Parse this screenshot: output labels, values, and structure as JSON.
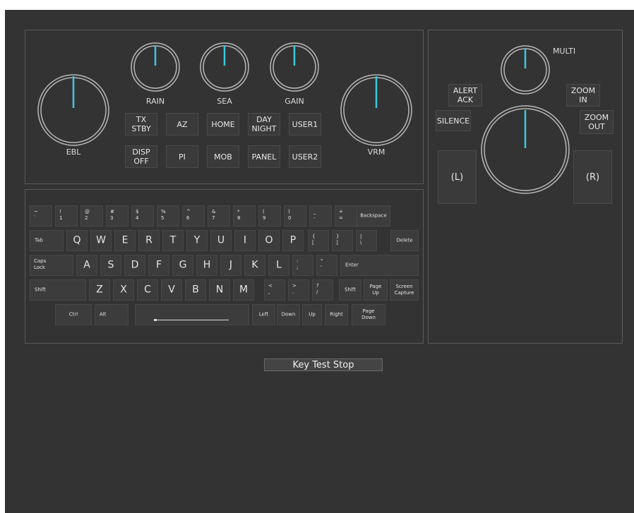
{
  "colors": {
    "background": "#333333",
    "needle": "#3cc8e0",
    "knob_ring": "#b8b8b8"
  },
  "knobs": {
    "ebl": "EBL",
    "rain": "RAIN",
    "sea": "SEA",
    "gain": "GAIN",
    "vrm": "VRM",
    "multi": "MULTI"
  },
  "buttons": {
    "tx_stby": "TX\nSTBY",
    "az": "AZ",
    "home": "HOME",
    "day_night": "DAY\nNIGHT",
    "user1": "USER1",
    "disp_off": "DISP\nOFF",
    "pi": "PI",
    "mob": "MOB",
    "panel": "PANEL",
    "user2": "USER2",
    "alert_ack": "ALERT\nACK",
    "zoom_in": "ZOOM\nIN",
    "silence": "SILENCE",
    "zoom_out": "ZOOM\nOUT",
    "left_click": "(L)",
    "right_click": "(R)"
  },
  "keyboard": {
    "row1": [
      {
        "t": "~",
        "b": "`"
      },
      {
        "t": "!",
        "b": "1"
      },
      {
        "t": "@",
        "b": "2"
      },
      {
        "t": "#",
        "b": "3"
      },
      {
        "t": "$",
        "b": "4"
      },
      {
        "t": "%",
        "b": "5"
      },
      {
        "t": "^",
        "b": "6"
      },
      {
        "t": "&",
        "b": "7"
      },
      {
        "t": "*",
        "b": "8"
      },
      {
        "t": "(",
        "b": "9"
      },
      {
        "t": ")",
        "b": "0"
      },
      {
        "t": "_",
        "b": "-"
      },
      {
        "t": "+",
        "b": "="
      }
    ],
    "backspace": "Backspace",
    "tab": "Tab",
    "row2_letters": [
      "Q",
      "W",
      "E",
      "R",
      "T",
      "Y",
      "U",
      "I",
      "O",
      "P"
    ],
    "row2_sym": [
      {
        "t": "{",
        "b": "["
      },
      {
        "t": "}",
        "b": "]"
      },
      {
        "t": "|",
        "b": "\\"
      }
    ],
    "delete": "Delete",
    "caps": "Caps\nLock",
    "row3_letters": [
      "A",
      "S",
      "D",
      "F",
      "G",
      "H",
      "J",
      "K",
      "L"
    ],
    "row3_sym": [
      {
        "t": ":",
        "b": ";"
      },
      {
        "t": "\"",
        "b": "'"
      }
    ],
    "enter": "Enter",
    "shift_left": "Shift",
    "row4_letters": [
      "Z",
      "X",
      "C",
      "V",
      "B",
      "N",
      "M"
    ],
    "row4_sym": [
      {
        "t": "<",
        "b": ","
      },
      {
        "t": ">",
        "b": "."
      },
      {
        "t": "?",
        "b": "/"
      }
    ],
    "shift_right": "Shift",
    "page_up": "Page\nUp",
    "screen_capture": "Screen\nCapture",
    "ctrl": "Ctrl",
    "alt": "Alt",
    "left": "Left",
    "down": "Down",
    "up": "Up",
    "right": "Right",
    "page_down": "Page\nDown"
  },
  "key_test_stop": "Key Test Stop"
}
